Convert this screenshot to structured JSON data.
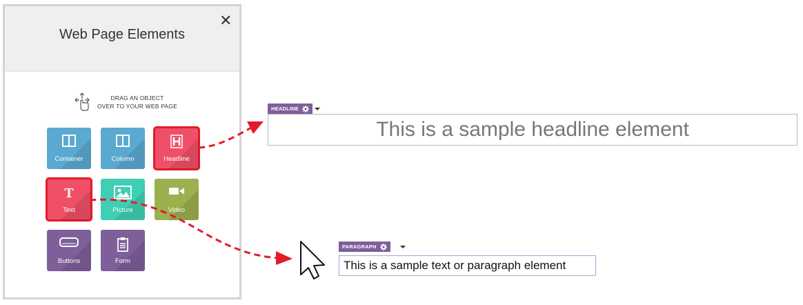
{
  "panel": {
    "title": "Web Page Elements",
    "close_icon": "close-icon",
    "drag_hint": {
      "line1": "DRAG AN OBJECT",
      "line2": "OVER TO YOUR WEB PAGE",
      "icon": "drag-hand-icon"
    }
  },
  "elements": [
    {
      "label": "Container",
      "icon": "container-icon",
      "color": "#5aa9d0",
      "selected": false
    },
    {
      "label": "Column",
      "icon": "column-icon",
      "color": "#5aa9d0",
      "selected": false
    },
    {
      "label": "Headline",
      "icon": "headline-icon",
      "color": "#ef5068",
      "selected": true
    },
    {
      "label": "Text",
      "icon": "text-icon",
      "color": "#ef5068",
      "selected": true
    },
    {
      "label": "Picture",
      "icon": "picture-icon",
      "color": "#3fcfb4",
      "selected": false
    },
    {
      "label": "Video",
      "icon": "video-icon",
      "color": "#9bb04e",
      "selected": false
    },
    {
      "label": "Buttons",
      "icon": "buttons-icon",
      "color": "#7e5f9a",
      "selected": false
    },
    {
      "label": "Form",
      "icon": "form-icon",
      "color": "#7e5f9a",
      "selected": false
    }
  ],
  "headline_element": {
    "tag": "HEADLINE",
    "text": "This is a sample headline element"
  },
  "paragraph_element": {
    "tag": "PARAGRAPH",
    "text": "This is a sample text or paragraph element"
  },
  "colors": {
    "accent_purple": "#7e5f9a",
    "highlight_red": "#e31b2a",
    "arrow_red": "#e31b2a"
  }
}
